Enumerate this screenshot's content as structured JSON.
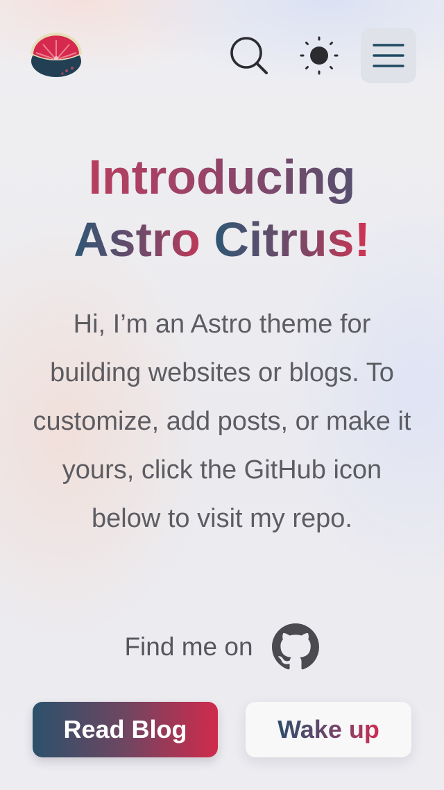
{
  "header": {
    "logo_icon": "grapefruit-slice-icon",
    "search_icon": "search-icon",
    "theme_icon": "sun-icon",
    "menu_icon": "hamburger-menu-icon"
  },
  "hero": {
    "title_line1": "Introducing",
    "title_line2_part1": "Astro ",
    "title_line2_part2": "Citrus!",
    "intro": "Hi, I’m an Astro theme for building websites or blogs. To customize, add posts, or make it yours, click the GitHub icon below to visit my repo.",
    "find_label": "Find me on",
    "social_icon": "github-icon"
  },
  "actions": {
    "read_blog_label": "Read Blog",
    "wake_up_label": "Wake up"
  },
  "colors": {
    "brand_red": "#d02a4c",
    "brand_blue": "#2c516b",
    "menu_button_bg": "#dfe2e8",
    "text_gray": "#5c5c62"
  }
}
